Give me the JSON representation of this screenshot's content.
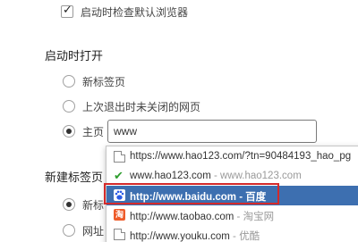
{
  "startup_check": {
    "label": "启动时检查默认浏览器",
    "checked": true
  },
  "on_startup": {
    "title": "启动时打开",
    "options": [
      {
        "label": "新标签页",
        "selected": false
      },
      {
        "label": "上次退出时未关闭的网页",
        "selected": false
      },
      {
        "label": "主页",
        "selected": true
      }
    ],
    "homepage_value": "www"
  },
  "autocomplete": {
    "items": [
      {
        "url": "https://www.hao123.com/?tn=90484193_hao_pg",
        "subtitle": "",
        "icon": "page-icon"
      },
      {
        "url": "www.hao123.com",
        "subtitle": " - www.hao123.com",
        "icon": "hao123-check-icon"
      },
      {
        "url": "http://www.baidu.com",
        "subtitle": " - 百度",
        "icon": "baidu-paw-icon",
        "highlighted": true
      },
      {
        "url": "http://www.taobao.com",
        "subtitle": " - 淘宝网",
        "icon": "taobao-icon"
      },
      {
        "url": "http://www.youku.com",
        "subtitle": " - 优酷",
        "icon": "page-icon"
      }
    ]
  },
  "new_tab": {
    "title": "新建标签页",
    "options": [
      {
        "label": "新标",
        "selected": true
      },
      {
        "label": "网址",
        "selected": false
      }
    ]
  },
  "colors": {
    "highlight": "#3d6fb0",
    "annotation_box": "#d42a2a",
    "hao_check": "#2e9e2e",
    "baidu_blue": "#2b5ce6"
  }
}
